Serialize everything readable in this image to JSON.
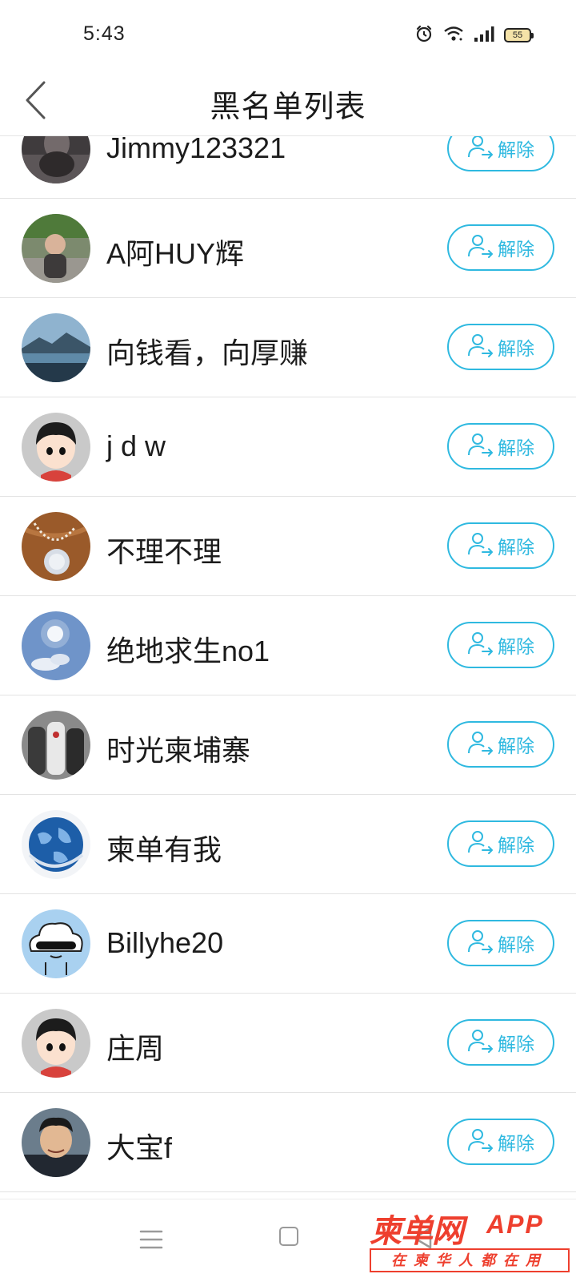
{
  "status_bar": {
    "time": "5:43",
    "battery_level": "55",
    "icons": [
      "alarm-icon",
      "wifi-icon",
      "signal-icon",
      "battery-icon"
    ]
  },
  "header": {
    "title": "黑名单列表",
    "back_icon": "chevron-left-icon"
  },
  "colors": {
    "accent": "#2fb9e0",
    "divider": "#e3e3e3",
    "watermark": "#ee3f2e"
  },
  "blacklist": {
    "unblock_icon": "user-remove-arrow-icon",
    "items": [
      {
        "name": "Jimmy123321",
        "action_label": "解除"
      },
      {
        "name": "A阿HUY辉",
        "action_label": "解除"
      },
      {
        "name": "向钱看，向厚赚",
        "action_label": "解除"
      },
      {
        "name": "j d w",
        "action_label": "解除"
      },
      {
        "name": "不理不理",
        "action_label": "解除"
      },
      {
        "name": "绝地求生no1",
        "action_label": "解除"
      },
      {
        "name": "时光柬埔寨",
        "action_label": "解除"
      },
      {
        "name": "柬单有我",
        "action_label": "解除"
      },
      {
        "name": "Billyhe20",
        "action_label": "解除"
      },
      {
        "name": "庄周",
        "action_label": "解除"
      },
      {
        "name": "大宝f",
        "action_label": "解除"
      }
    ]
  },
  "nav_bar": {
    "icons": [
      "menu-icon",
      "home-square-icon",
      "back-triangle-icon"
    ]
  },
  "watermark": {
    "brand": "柬单网",
    "suffix": "APP",
    "tagline": "在柬华人都在用"
  }
}
